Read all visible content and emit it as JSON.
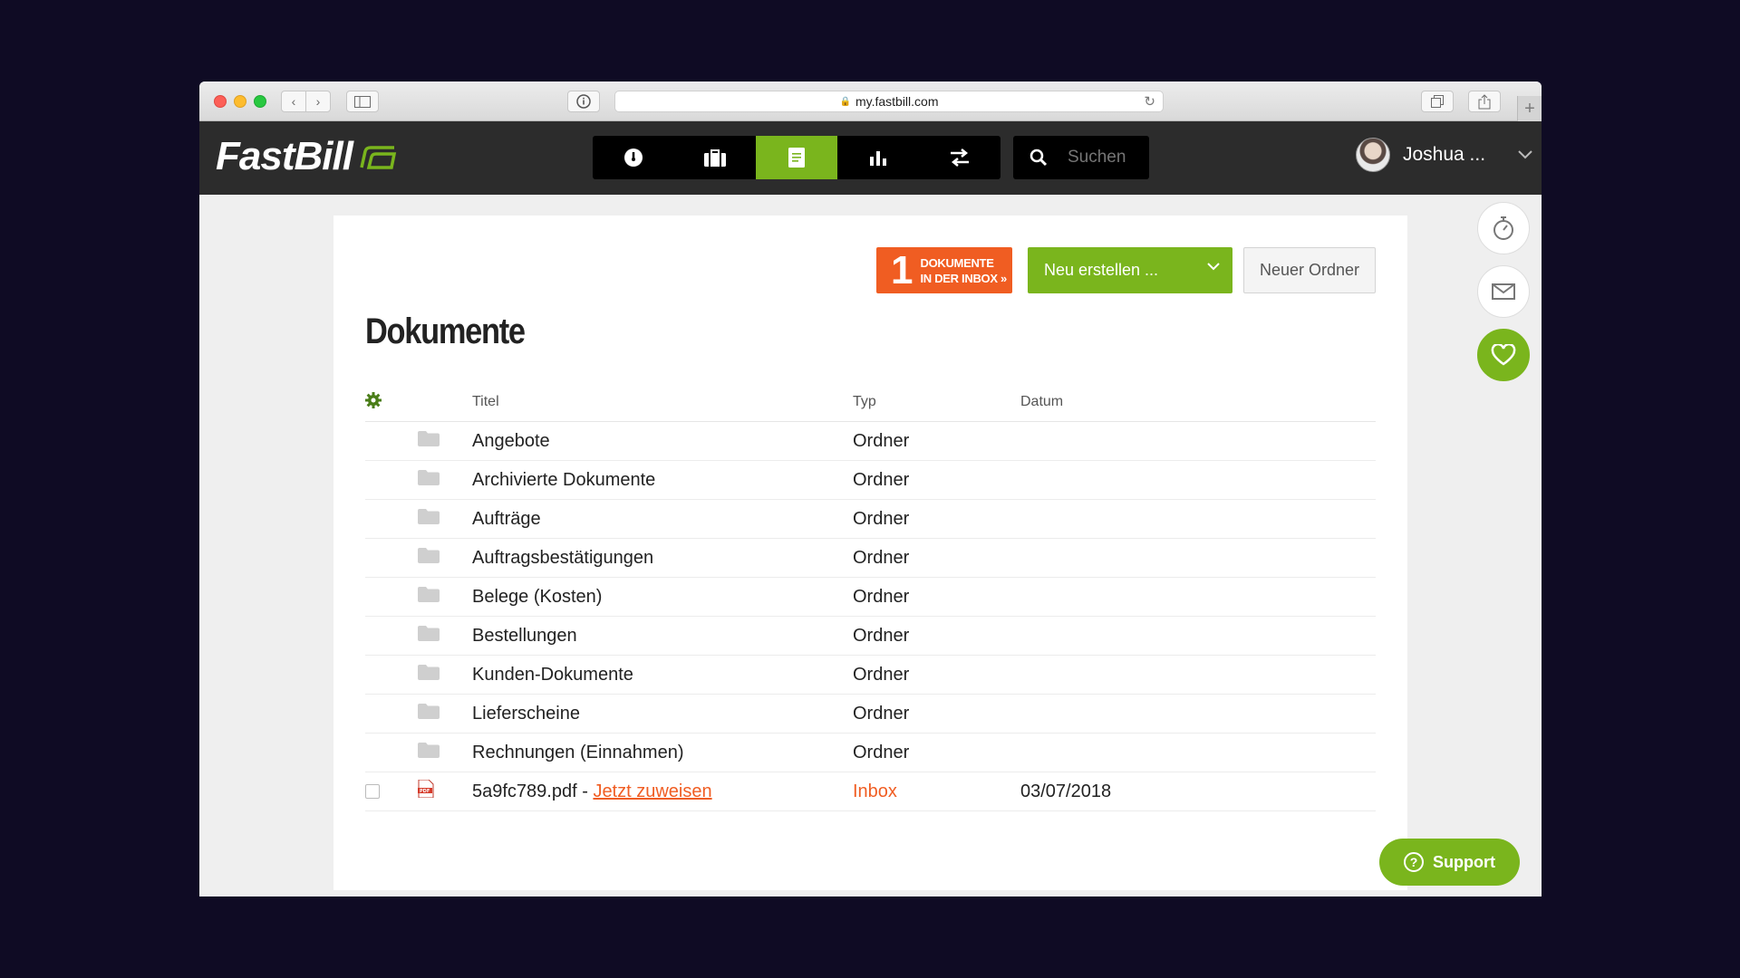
{
  "browser": {
    "url": "my.fastbill.com",
    "new_tab_label": "+"
  },
  "app": {
    "logo_text": "FastBill",
    "nav": [
      {
        "name": "dashboard",
        "icon": "speedometer-icon",
        "active": false
      },
      {
        "name": "clients",
        "icon": "briefcase-icon",
        "active": false
      },
      {
        "name": "documents",
        "icon": "document-icon",
        "active": true
      },
      {
        "name": "reports",
        "icon": "bar-chart-icon",
        "active": false
      },
      {
        "name": "transactions",
        "icon": "transfer-arrows-icon",
        "active": false
      }
    ],
    "search_placeholder": "Suchen",
    "user_name": "Joshua ..."
  },
  "toolbar": {
    "inbox_count": "1",
    "inbox_line1": "DOKUMENTE",
    "inbox_line2": "IN DER INBOX »",
    "new_label": "Neu erstellen ...",
    "new_folder_label": "Neuer Ordner"
  },
  "page": {
    "title": "Dokumente"
  },
  "table": {
    "headers": {
      "title": "Titel",
      "type": "Typ",
      "date": "Datum"
    },
    "folders": [
      {
        "title": "Angebote",
        "type": "Ordner"
      },
      {
        "title": "Archivierte Dokumente",
        "type": "Ordner"
      },
      {
        "title": "Aufträge",
        "type": "Ordner"
      },
      {
        "title": "Auftragsbestätigungen",
        "type": "Ordner"
      },
      {
        "title": "Belege (Kosten)",
        "type": "Ordner"
      },
      {
        "title": "Bestellungen",
        "type": "Ordner"
      },
      {
        "title": "Kunden-Dokumente",
        "type": "Ordner"
      },
      {
        "title": "Lieferscheine",
        "type": "Ordner"
      },
      {
        "title": "Rechnungen (Einnahmen)",
        "type": "Ordner"
      }
    ],
    "file": {
      "name": "5a9fc789.pdf",
      "separator": " - ",
      "link": "Jetzt zuweisen",
      "type": "Inbox",
      "date": "03/07/2018"
    }
  },
  "support_label": "Support",
  "colors": {
    "accent_green": "#7ab51d",
    "accent_orange": "#f05d22",
    "header_dark": "#2c2c2c"
  }
}
